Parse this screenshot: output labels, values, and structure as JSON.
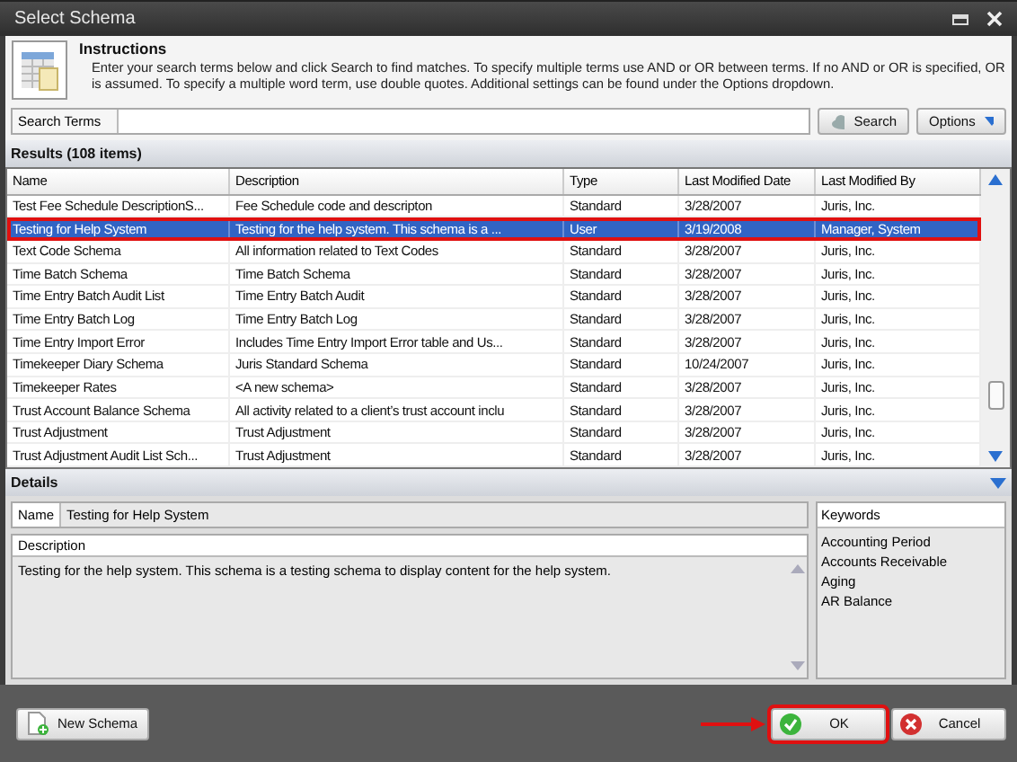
{
  "window": {
    "title": "Select Schema"
  },
  "instructions": {
    "title": "Instructions",
    "text": "Enter your search terms below and click Search to find matches.  To specify multiple terms use AND or OR between terms.  If no AND or OR is specified, OR is assumed.  To specify a multiple word term, use double quotes.  Additional settings can be found under the Options dropdown."
  },
  "search": {
    "label": "Search Terms",
    "button": "Search",
    "options": "Options"
  },
  "results": {
    "title": "Results (108 items)",
    "columns": [
      "Name",
      "Description",
      "Type",
      "Last Modified Date",
      "Last Modified By"
    ],
    "rows": [
      {
        "cells": [
          "Test Fee Schedule DescriptionS...",
          "Fee Schedule code and descripton",
          "Standard",
          "3/28/2007",
          "Juris, Inc."
        ],
        "selected": false,
        "callout": false
      },
      {
        "cells": [
          "Testing for Help System",
          "Testing for the help system.  This schema is a ...",
          "User",
          "3/19/2008",
          "Manager, System"
        ],
        "selected": true,
        "callout": true
      },
      {
        "cells": [
          "Text Code Schema",
          "All information related to Text Codes",
          "Standard",
          "3/28/2007",
          "Juris, Inc."
        ],
        "selected": false,
        "callout": false
      },
      {
        "cells": [
          "Time Batch Schema",
          "Time Batch Schema",
          "Standard",
          "3/28/2007",
          "Juris, Inc."
        ],
        "selected": false,
        "callout": false
      },
      {
        "cells": [
          "Time Entry Batch Audit List",
          "Time Entry Batch Audit",
          "Standard",
          "3/28/2007",
          "Juris, Inc."
        ],
        "selected": false,
        "callout": false
      },
      {
        "cells": [
          "Time Entry Batch Log",
          "Time Entry Batch Log",
          "Standard",
          "3/28/2007",
          "Juris, Inc."
        ],
        "selected": false,
        "callout": false
      },
      {
        "cells": [
          "Time Entry Import Error",
          "Includes Time Entry Import Error table and Us...",
          "Standard",
          "3/28/2007",
          "Juris, Inc."
        ],
        "selected": false,
        "callout": false
      },
      {
        "cells": [
          "Timekeeper Diary Schema",
          "Juris Standard Schema",
          "Standard",
          "10/24/2007",
          "Juris, Inc."
        ],
        "selected": false,
        "callout": false
      },
      {
        "cells": [
          "Timekeeper Rates",
          "<A new schema>",
          "Standard",
          "3/28/2007",
          "Juris, Inc."
        ],
        "selected": false,
        "callout": false
      },
      {
        "cells": [
          "Trust Account Balance Schema",
          "All activity related to a client’s trust account inclu",
          "Standard",
          "3/28/2007",
          "Juris, Inc."
        ],
        "selected": false,
        "callout": false
      },
      {
        "cells": [
          "Trust Adjustment",
          "Trust Adjustment",
          "Standard",
          "3/28/2007",
          "Juris, Inc."
        ],
        "selected": false,
        "callout": false
      },
      {
        "cells": [
          "Trust Adjustment Audit List Sch...",
          "Trust Adjustment",
          "Standard",
          "3/28/2007",
          "Juris, Inc."
        ],
        "selected": false,
        "callout": false
      }
    ]
  },
  "details": {
    "title": "Details",
    "name_label": "Name",
    "name_value": "Testing for Help System",
    "description_label": "Description",
    "description": "Testing for the help system.  This schema is a testing schema to display content for the help system.",
    "keywords_label": "Keywords",
    "keywords": [
      "Accounting Period",
      "Accounts Receivable",
      "Aging",
      "AR Balance"
    ]
  },
  "footer": {
    "new_button": "New Schema",
    "ok": {
      "label": "OK",
      "callout": true
    },
    "cancel": "Cancel"
  }
}
